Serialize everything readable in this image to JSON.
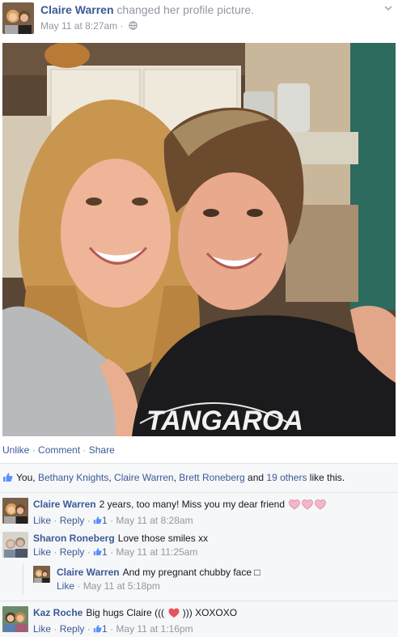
{
  "post": {
    "author": "Claire Warren",
    "action": "changed her profile picture.",
    "timestamp": "May 11 at 8:27am",
    "separator": " · "
  },
  "actions": {
    "unlike": "Unlike",
    "comment": "Comment",
    "share": "Share",
    "dot": " · "
  },
  "likes": {
    "you": "You,",
    "person1": "Bethany Knights",
    "comma1": ",",
    "person2": "Claire Warren",
    "comma2": ",",
    "person3": "Brett Roneberg",
    "and": "and",
    "others": "19 others",
    "suffix": "like this."
  },
  "comments": [
    {
      "name": "Claire Warren",
      "text": "2 years, too many! Miss you my dear friend",
      "like": "Like",
      "reply": "Reply",
      "count": "1",
      "time": "May 11 at 8:28am"
    },
    {
      "name": "Sharon Roneberg",
      "text": "Love those smiles xx",
      "like": "Like",
      "reply": "Reply",
      "count": "1",
      "time": "May 11 at 11:25am"
    },
    {
      "name": "Claire Warren",
      "text": "And my pregnant chubby face",
      "emoji": "□",
      "like": "Like",
      "time": "May 11 at 5:18pm"
    },
    {
      "name": "Kaz Roche",
      "text_before": "Big hugs Claire (((",
      "text_after": "))) XOXOXO",
      "like": "Like",
      "reply": "Reply",
      "count": "1",
      "time": "May 11 at 1:16pm"
    }
  ],
  "photo_text": "TANGAROA",
  "colors": {
    "link": "#3b5998",
    "meta": "#9197a3",
    "ufi_bg": "#f6f7f8",
    "heart_pink": "#f4b6c8",
    "heart_red": "#e8545b"
  }
}
